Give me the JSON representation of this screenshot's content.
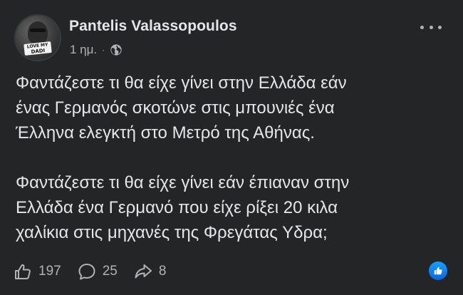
{
  "post": {
    "author": {
      "name": "Pantelis Valassopoulos",
      "avatar_text_top": "LOVE MY",
      "avatar_text_bottom": "DADI"
    },
    "time": "1 ημ.",
    "separator": "·",
    "privacy_icon": "globe-icon",
    "more_icon": "more-dots-icon",
    "paragraphs": [
      {
        "lines": [
          "Φαντάζεστε τι θα είχε γίνει στην Ελλάδα εάν",
          "ένας Γερμανός σκοτώνε στις μπουνιές ένα",
          "Έλληνα ελεγκτή στο Μετρό της Αθήνας."
        ]
      },
      {
        "lines": [
          "Φαντάζεστε τι θα είχε γίνει εάν έπιαναν στην",
          "Ελλάδα ένα Γερμανό που είχε ρίξει 20 κιλα",
          "χαλίκια στις μηχανές της Φρεγάτας Υδρα;"
        ]
      }
    ],
    "actions": {
      "likes": "197",
      "comments": "25",
      "shares": "8"
    },
    "colors": {
      "background": "#242526",
      "text_primary": "#e4e6eb",
      "text_secondary": "#b0b3b8",
      "like_badge": "#1877f2"
    }
  }
}
